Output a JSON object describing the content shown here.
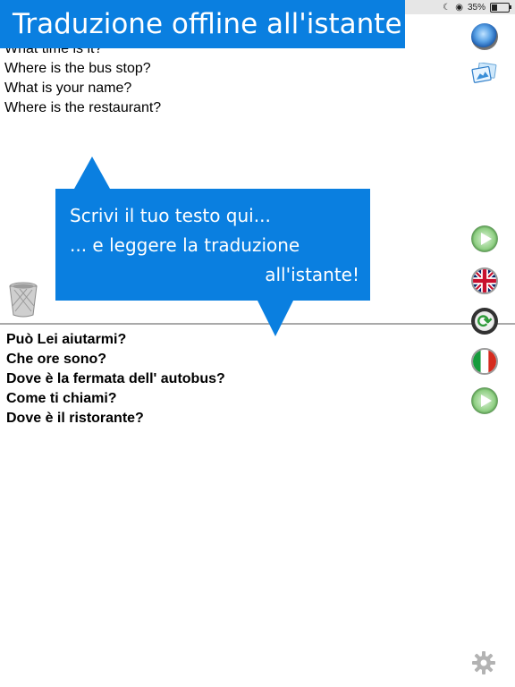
{
  "status_bar": {
    "battery": "35%"
  },
  "banner": {
    "title": "Traduzione offline all'istante"
  },
  "source": {
    "lines": [
      "What time is it?",
      "Where is the bus stop?",
      "What is your name?",
      "Where is the restaurant?"
    ]
  },
  "callout": {
    "line1": "Scrivi il tuo testo qui...",
    "line2": "... e leggere la traduzione",
    "line3": "all'istante!"
  },
  "target": {
    "lines": [
      "Può Lei aiutarmi?",
      "Che ore sono?",
      "Dove è la fermata dell' autobus?",
      "Come ti chiami?",
      "Dove è il ristorante?"
    ]
  },
  "icons": {
    "mic": "microphone-icon",
    "photo": "photo-icon",
    "trash": "trash-icon",
    "play": "play-icon",
    "flag_source": "uk-flag-icon",
    "swap": "swap-icon",
    "flag_target": "italy-flag-icon",
    "settings": "gear-icon"
  },
  "colors": {
    "accent": "#0a7fe0",
    "divider": "#a9a9a9"
  }
}
